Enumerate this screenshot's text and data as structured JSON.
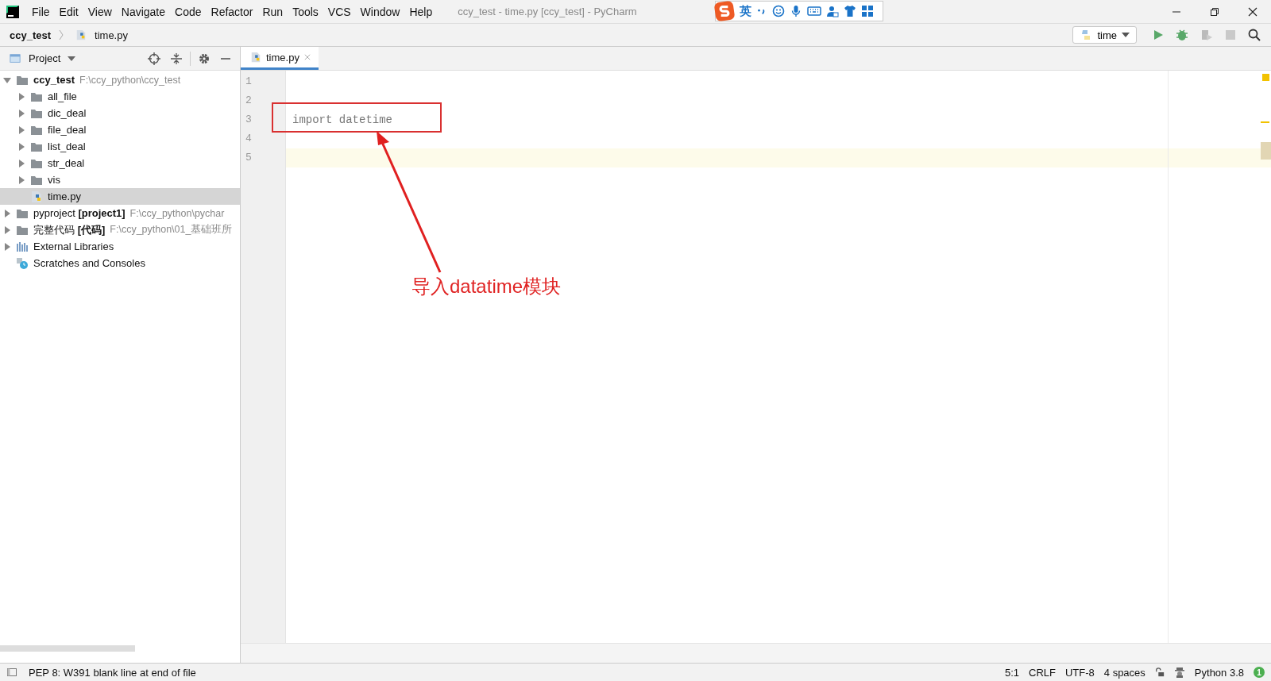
{
  "window": {
    "title": "ccy_test - time.py [ccy_test] - PyCharm"
  },
  "menu": [
    "File",
    "Edit",
    "View",
    "Navigate",
    "Code",
    "Refactor",
    "Run",
    "Tools",
    "VCS",
    "Window",
    "Help"
  ],
  "ime_toolbar": {
    "mode": "英"
  },
  "breadcrumbs": [
    {
      "label": "ccy_test",
      "kind": "project"
    },
    {
      "label": "time.py",
      "kind": "python-file"
    }
  ],
  "run_config": {
    "label": "time"
  },
  "project_panel": {
    "title": "Project"
  },
  "tree": [
    {
      "name": "ccy_test",
      "kind": "project",
      "path": "F:\\ccy_python\\ccy_test",
      "expanded": true,
      "selected": false,
      "children": [
        {
          "name": "all_file",
          "kind": "folder",
          "expanded": false,
          "selected": false
        },
        {
          "name": "dic_deal",
          "kind": "folder",
          "expanded": false,
          "selected": false
        },
        {
          "name": "file_deal",
          "kind": "folder",
          "expanded": false,
          "selected": false
        },
        {
          "name": "list_deal",
          "kind": "folder",
          "expanded": false,
          "selected": false
        },
        {
          "name": "str_deal",
          "kind": "folder",
          "expanded": false,
          "selected": false
        },
        {
          "name": "vis",
          "kind": "folder",
          "expanded": false,
          "selected": false
        },
        {
          "name": "time.py",
          "kind": "python-file",
          "selected": true
        }
      ]
    },
    {
      "name": "pyproject **[project1]**",
      "kind": "folder",
      "path": "F:\\ccy_python\\pychar",
      "expanded": false,
      "selected": false
    },
    {
      "name": "完整代码 **[代码]**",
      "kind": "folder",
      "path": "F:\\ccy_python\\01_基础班所",
      "expanded": false,
      "selected": false
    },
    {
      "name": "External Libraries",
      "kind": "libraries",
      "expanded": false,
      "selected": false
    },
    {
      "name": "Scratches and Consoles",
      "kind": "scratches",
      "selected": false
    }
  ],
  "tabs": [
    {
      "label": "time.py",
      "selected": true
    }
  ],
  "editor": {
    "lines": [
      {
        "number": "1",
        "current": false
      },
      {
        "number": "2",
        "current": false
      },
      {
        "number": "3",
        "code": "import datetime",
        "current": false
      },
      {
        "number": "4",
        "current": false
      },
      {
        "number": "5",
        "current": true
      }
    ]
  },
  "annotation": {
    "text": "导入datatime模块"
  },
  "status_bar": {
    "message": "PEP 8: W391 blank line at end of file",
    "items": [
      "5:1",
      "CRLF",
      "UTF-8",
      "4 spaces"
    ],
    "interpreter": "Python 3.8",
    "notifications": "1"
  }
}
